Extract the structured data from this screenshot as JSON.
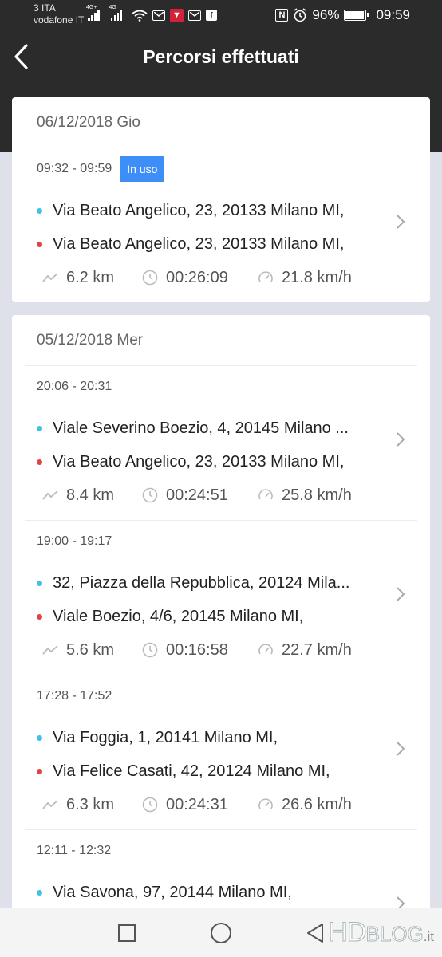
{
  "status_bar": {
    "carrier_line1": "3 ITA",
    "carrier_line2": "vodafone IT",
    "net1": "4G+",
    "net2": "4G",
    "battery": "96%",
    "time": "09:59"
  },
  "header": {
    "title": "Percorsi effettuati"
  },
  "groups": [
    {
      "date": "06/12/2018 Gio",
      "trips": [
        {
          "time": "09:32 - 09:59",
          "badge": "In uso",
          "from": "Via Beato Angelico, 23, 20133 Milano MI,",
          "to": "Via Beato Angelico, 23, 20133 Milano MI,",
          "distance": "6.2 km",
          "duration": "00:26:09",
          "speed": "21.8 km/h"
        }
      ]
    },
    {
      "date": "05/12/2018 Mer",
      "trips": [
        {
          "time": "20:06 - 20:31",
          "from": "Viale Severino Boezio, 4, 20145 Milano ...",
          "to": "Via Beato Angelico, 23, 20133 Milano MI,",
          "distance": "8.4 km",
          "duration": "00:24:51",
          "speed": "25.8 km/h"
        },
        {
          "time": "19:00 - 19:17",
          "from": "32, Piazza della Repubblica, 20124 Mila...",
          "to": "Viale Boezio, 4/6, 20145 Milano MI,",
          "distance": "5.6 km",
          "duration": "00:16:58",
          "speed": "22.7 km/h"
        },
        {
          "time": "17:28 - 17:52",
          "from": "Via Foggia, 1, 20141 Milano MI,",
          "to": "Via Felice Casati, 42, 20124 Milano MI,",
          "distance": "6.3 km",
          "duration": "00:24:31",
          "speed": "26.6 km/h"
        },
        {
          "time": "12:11 - 12:32",
          "from": "Via Savona, 97, 20144 Milano MI,"
        }
      ]
    }
  ],
  "watermark": {
    "hd": "HD",
    "blog": "BLOG",
    "it": ".it"
  },
  "colors": {
    "header_bg": "#2b2b2b",
    "page_bg": "#dfe1ea",
    "badge_bg": "#3e8ef7",
    "start_dot": "#3fc1e8",
    "end_dot": "#e04545"
  },
  "icons": {
    "back": "chevron-left-icon",
    "distance": "trend-line-icon",
    "duration": "clock-icon",
    "speed": "speedometer-icon",
    "open": "chevron-right-icon"
  }
}
